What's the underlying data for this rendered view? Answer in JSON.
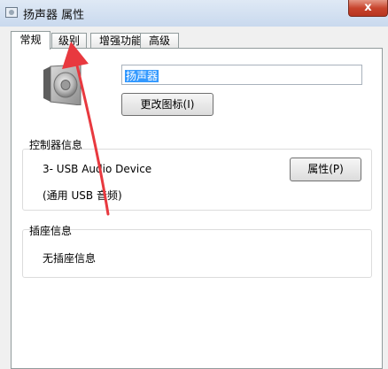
{
  "window": {
    "title": "扬声器 属性",
    "close_label": "x"
  },
  "tabs": [
    {
      "label": "常规"
    },
    {
      "label": "级别"
    },
    {
      "label": "增强功能"
    },
    {
      "label": "高级"
    }
  ],
  "device": {
    "name_value": "扬声器",
    "change_icon_label": "更改图标(I)"
  },
  "controller": {
    "group_label": "控制器信息",
    "device_name": "3- USB Audio Device",
    "device_desc": "(通用 USB 音频)",
    "properties_label": "属性(P)"
  },
  "jack": {
    "group_label": "插座信息",
    "status": "无插座信息"
  },
  "colors": {
    "annotation_arrow": "#e8393f"
  }
}
